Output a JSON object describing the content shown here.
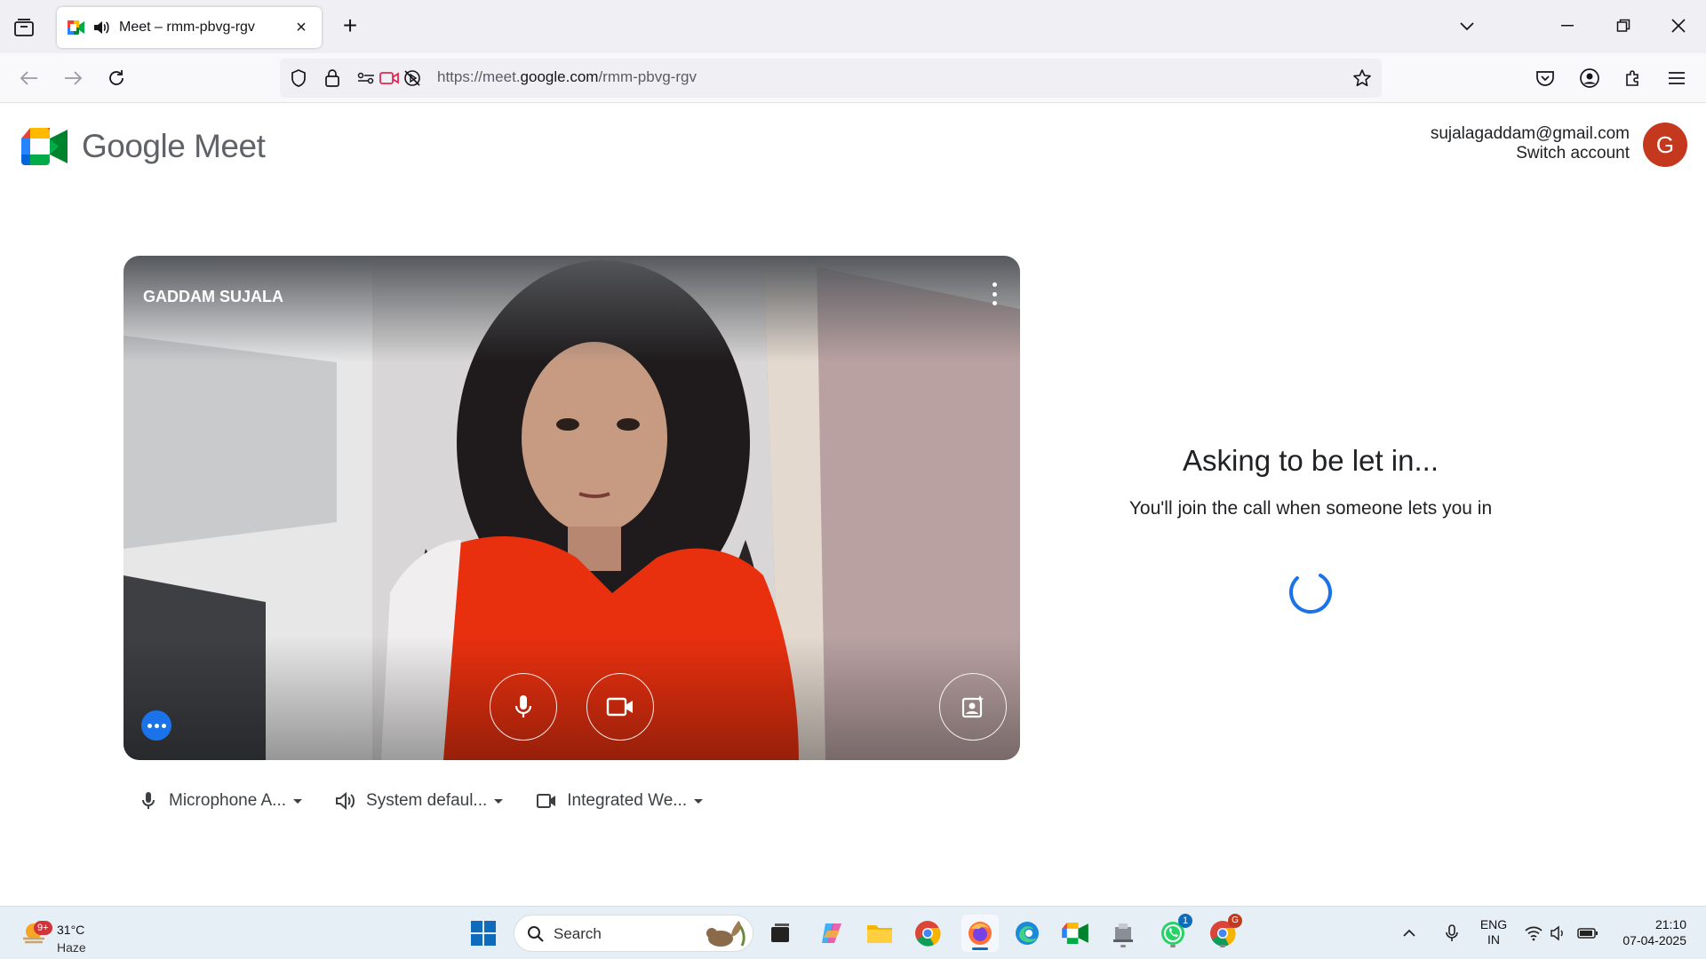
{
  "browser": {
    "tab_title": "Meet – rmm-pbvg-rgv",
    "url_prefix": "https://meet.",
    "url_domain": "google.com",
    "url_path": "/rmm-pbvg-rgv"
  },
  "meet": {
    "brand": "Google Meet",
    "account_email": "sujalagaddam@gmail.com",
    "switch_account": "Switch account",
    "avatar_letter": "G",
    "self_name": "GADDAM SUJALA",
    "waiting_title": "Asking to be let in...",
    "waiting_sub": "You'll join the call when someone lets you in",
    "devices": {
      "microphone": "Microphone A...",
      "speaker": "System defaul...",
      "camera": "Integrated We..."
    }
  },
  "taskbar": {
    "weather_badge": "9+",
    "weather_temp": "31°C",
    "weather_cond": "Haze",
    "search_label": "Search",
    "whatsapp_badge": "1",
    "chrome_badge": "G",
    "lang_line1": "ENG",
    "lang_line2": "IN",
    "time": "21:10",
    "date": "07-04-2025"
  },
  "colors": {
    "avatar_bg": "#c4391d",
    "meet_blue": "#1a73e8",
    "spinner": "#1a73e8"
  }
}
